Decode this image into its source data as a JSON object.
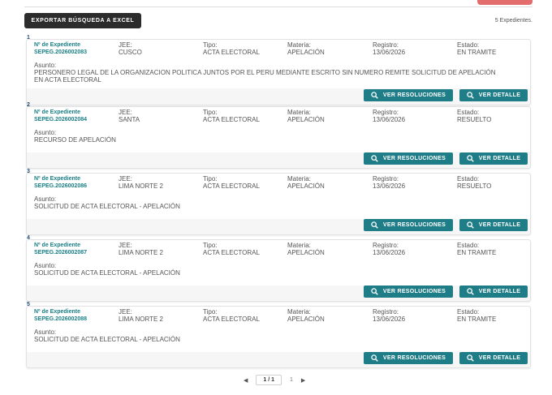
{
  "header": {
    "export_label": "EXPORTAR BÚSQUEDA A EXCEL",
    "count_text": "5 Expedientes."
  },
  "labels": {
    "expediente": "Nº de Expediente",
    "jee": "JEE:",
    "tipo": "Tipo:",
    "materia": "Materia:",
    "registro": "Registro:",
    "estado": "Estado:",
    "asunto": "Asunto:",
    "ver_resoluciones": "VER RESOLUCIONES",
    "ver_detalle": "VER DETALLE"
  },
  "records": [
    {
      "num": "1",
      "expediente": "SEPEG.2026002083",
      "jee": "CUSCO",
      "tipo": "ACTA ELECTORAL",
      "materia": "APELACIÓN",
      "registro": "13/06/2026",
      "estado": "EN TRAMITE",
      "asunto": "PERSONERO LEGAL DE LA ORGANIZACION POLITICA JUNTOS POR EL PERU MEDIANTE ESCRITO SIN NUMERO REMITE SOLICITUD DE APELACIÓN EN ACTA ELECTORAL"
    },
    {
      "num": "2",
      "expediente": "SEPEG.2026002084",
      "jee": "SANTA",
      "tipo": "ACTA ELECTORAL",
      "materia": "APELACIÓN",
      "registro": "13/06/2026",
      "estado": "RESUELTO",
      "asunto": "RECURSO DE APELACIÓN"
    },
    {
      "num": "3",
      "expediente": "SEPEG.2026002086",
      "jee": "LIMA NORTE 2",
      "tipo": "ACTA ELECTORAL",
      "materia": "APELACIÓN",
      "registro": "13/06/2026",
      "estado": "RESUELTO",
      "asunto": "SOLICITUD DE ACTA ELECTORAL - APELACIÓN"
    },
    {
      "num": "4",
      "expediente": "SEPEG.2026002087",
      "jee": "LIMA NORTE 2",
      "tipo": "ACTA ELECTORAL",
      "materia": "APELACIÓN",
      "registro": "13/06/2026",
      "estado": "EN TRAMITE",
      "asunto": "SOLICITUD DE ACTA ELECTORAL - APELACIÓN"
    },
    {
      "num": "5",
      "expediente": "SEPEG.2026002088",
      "jee": "LIMA NORTE 2",
      "tipo": "ACTA ELECTORAL",
      "materia": "APELACIÓN",
      "registro": "13/06/2026",
      "estado": "EN TRAMITE",
      "asunto": "SOLICITUD DE ACTA ELECTORAL - APELACIÓN"
    }
  ],
  "pagination": {
    "prev_icon": "chevron-left-icon",
    "current": "1 / 1",
    "page": "1",
    "next_icon": "chevron-right-icon"
  },
  "colors": {
    "accent": "#1e7d86",
    "export_bg": "#2c2c2c",
    "top_red": "#e36c6c"
  }
}
